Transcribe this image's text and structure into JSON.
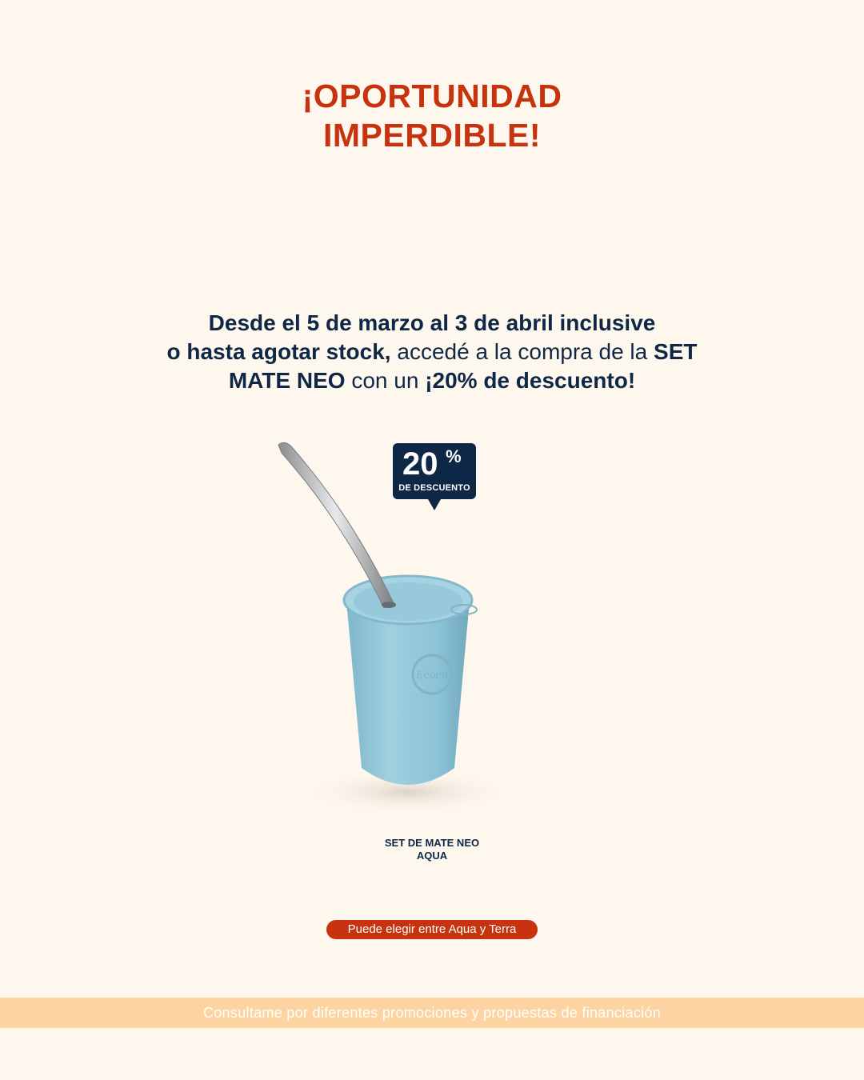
{
  "headline": {
    "line1": "¡OPORTUNIDAD",
    "line2": "IMPERDIBLE!"
  },
  "promo_copy": {
    "p1_bold": "Desde el 5 de marzo al 3 de abril inclusive",
    "p2_bold": "o hasta agotar stock,",
    "p2_text": " accedé a la compra de la ",
    "p2_bold_end": "SET",
    "p3_bold": "MATE NEO",
    "p3_text": " con un ",
    "p3_bold_end": "¡20% de descuento!"
  },
  "badge": {
    "number": "20",
    "percent": "%",
    "label": "DE DESCUENTO"
  },
  "product": {
    "name_line1": "SET DE MATE NEO",
    "name_line2": "AQUA",
    "logo_text": "Ecocu",
    "icons": [
      "mate-cup-icon",
      "bombilla-straw-icon"
    ]
  },
  "pill_note": "Puede elegir entre Aqua y Terra",
  "footer_note": "Consultame por diferentes promociones y propuestas de financiación",
  "colors": {
    "background": "#fef7ee",
    "accent_red": "#c8330f",
    "navy": "#0e2746",
    "aqua": "#8fc3d6",
    "footer_band": "#fdd3a1"
  }
}
